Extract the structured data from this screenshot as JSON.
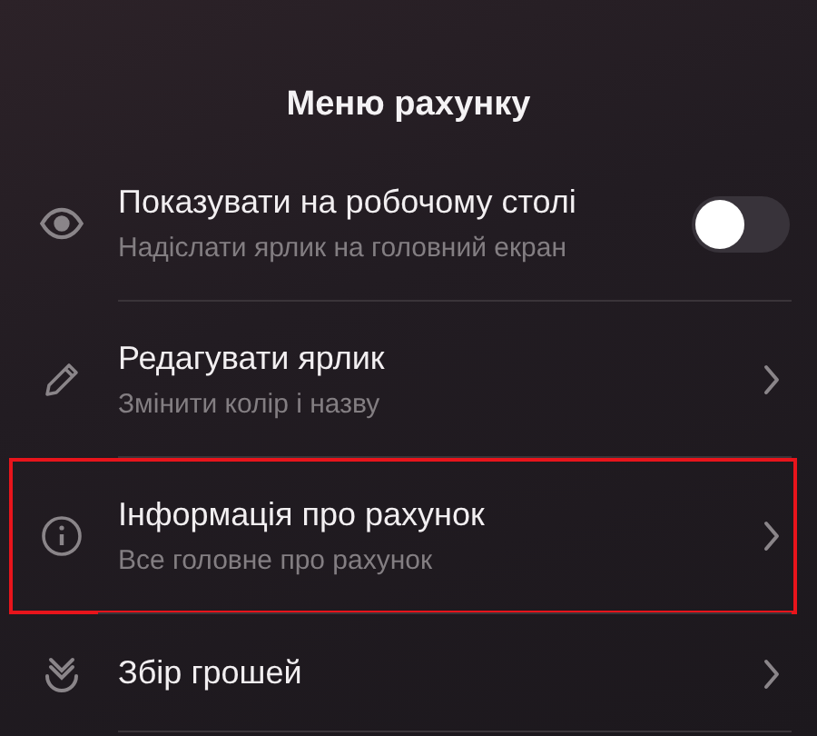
{
  "title": "Меню рахунку",
  "items": [
    {
      "kind": "toggle",
      "label": "Показувати на робочому столі",
      "subtitle": "Надіслати ярлик на головний екран",
      "on": false,
      "highlighted": false
    },
    {
      "kind": "link",
      "label": "Редагувати ярлик",
      "subtitle": "Змінити колір і назву",
      "highlighted": false
    },
    {
      "kind": "link",
      "label": "Інформація про рахунок",
      "subtitle": "Все головне про рахунок",
      "highlighted": true
    },
    {
      "kind": "link",
      "label": "Збір грошей",
      "highlighted": false
    }
  ]
}
